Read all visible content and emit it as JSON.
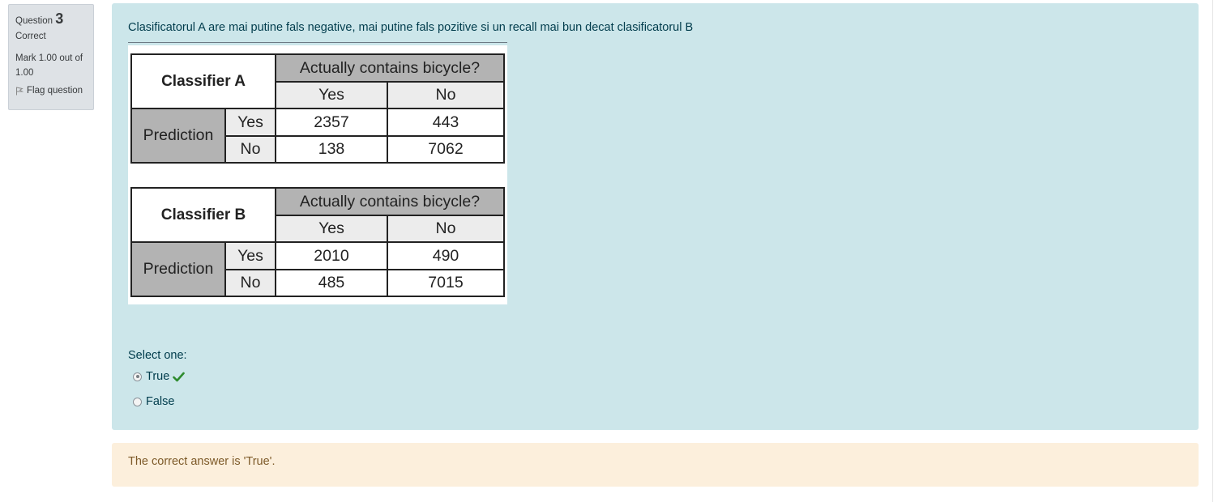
{
  "info": {
    "question_label": "Question",
    "question_number": "3",
    "state": "Correct",
    "grade": "Mark 1.00 out of 1.00",
    "flag_label": "Flag question"
  },
  "question": {
    "text": "Clasificatorul A are mai putine fals negative, mai putine fals pozitive si un recall mai bun decat clasificatorul B",
    "tables": [
      {
        "classifier": "Classifier A",
        "actual_header": "Actually contains bicycle?",
        "col_yes": "Yes",
        "col_no": "No",
        "prediction_label": "Prediction",
        "row_yes": "Yes",
        "row_no": "No",
        "yes_yes": "2357",
        "yes_no": "443",
        "no_yes": "138",
        "no_no": "7062"
      },
      {
        "classifier": "Classifier B",
        "actual_header": "Actually contains bicycle?",
        "col_yes": "Yes",
        "col_no": "No",
        "prediction_label": "Prediction",
        "row_yes": "Yes",
        "row_no": "No",
        "yes_yes": "2010",
        "yes_no": "490",
        "no_yes": "485",
        "no_no": "7015"
      }
    ]
  },
  "answer": {
    "prompt": "Select one:",
    "options": [
      {
        "label": "True",
        "selected": true,
        "correct_mark": "check-icon"
      },
      {
        "label": "False",
        "selected": false
      }
    ]
  },
  "feedback": {
    "text": "The correct answer is 'True'."
  },
  "colors": {
    "content_bg": "#cce6ea",
    "feedback_bg": "#fcefdc",
    "check": "#2e8b2e"
  }
}
